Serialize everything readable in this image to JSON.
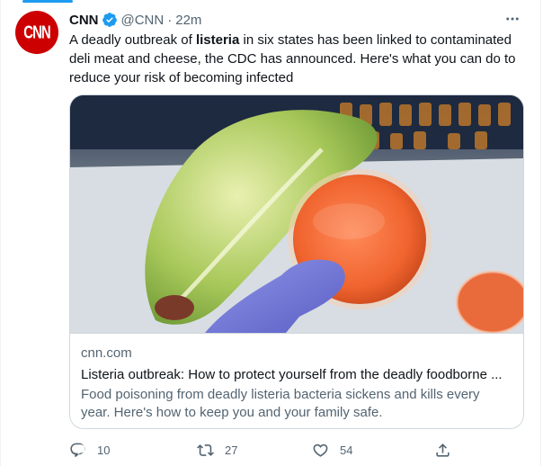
{
  "author": {
    "name": "CNN",
    "handle": "@CNN",
    "separator": "·",
    "time": "22m",
    "avatar_text": "CNN"
  },
  "tweet": {
    "text_before": "A deadly outbreak of ",
    "text_bold": "listeria",
    "text_after": " in six states has been linked to contaminated deli meat and cheese, the CDC has announced. Here's what you can do to reduce your risk of becoming infected"
  },
  "card": {
    "domain": "cnn.com",
    "title": "Listeria outbreak: How to protect yourself from the deadly foodborne ...",
    "description": "Food poisoning from deadly listeria bacteria sickens and kills every year. Here's how to keep you and your family safe."
  },
  "actions": {
    "replies": "10",
    "retweets": "27",
    "likes": "54"
  },
  "icons": [
    "verified-badge-icon",
    "more-icon",
    "reply-icon",
    "retweet-icon",
    "like-icon",
    "share-icon"
  ],
  "colors": {
    "accent": "#1d9bf0",
    "secondary_text": "#536471",
    "cnn_red": "#cc0000"
  }
}
